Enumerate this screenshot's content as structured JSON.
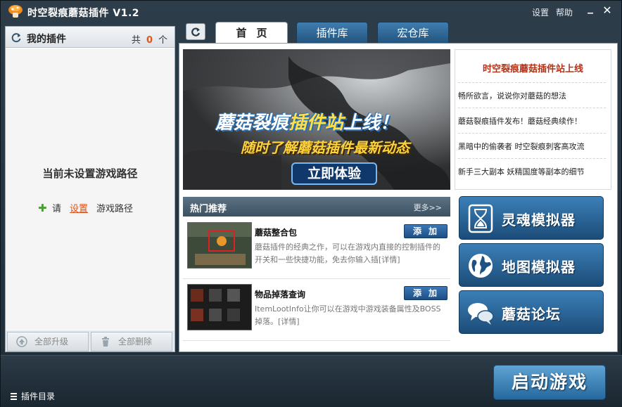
{
  "titlebar": {
    "title": "时空裂痕蘑菇插件 V1.2",
    "settings": "设置",
    "help": "帮助",
    "minimize": "▁",
    "close": "✕"
  },
  "left_panel": {
    "title": "我的插件",
    "count_prefix": "共",
    "count": "0",
    "count_suffix": "个",
    "no_path_message": "当前未设置游戏路径",
    "prompt_please": "请",
    "prompt_set_link": "设置",
    "prompt_game_path": "游戏路径",
    "upgrade_all": "全部升级",
    "delete_all": "全部删除"
  },
  "tabs": [
    {
      "label": "首页",
      "active": true
    },
    {
      "label": "插件库",
      "active": false
    },
    {
      "label": "宏仓库",
      "active": false
    }
  ],
  "banner": {
    "line1a": "蘑菇裂痕",
    "line1b": "插件站",
    "line1c": "上线！",
    "line2": "随时了解蘑菇插件最新动态",
    "button": "立即体验"
  },
  "news": {
    "title": "时空裂痕蘑菇插件站上线",
    "items": [
      "畅所欲言，说说你对蘑菇的想法",
      "蘑菇裂痕插件发布！蘑菇经典续作！",
      "黑暗中的偷袭者 时空裂痕刺客高攻流",
      "新手三大副本 妖精国度等副本的细节"
    ]
  },
  "hot": {
    "title": "热门推荐",
    "more": "更多>>",
    "plugins": [
      {
        "name": "蘑菇整合包",
        "add": "添加",
        "desc": "蘑菇插件的经典之作，可以在游戏内直接的控制插件的开关和一些快捷功能，免去你输入插",
        "detail": "[详情]"
      },
      {
        "name": "物品掉落查询",
        "add": "添加",
        "desc": "ItemLootInfo让你可以在游戏中游戏装备属性及BOSS掉落。",
        "detail": "[详情]"
      }
    ]
  },
  "tools": [
    {
      "label": "灵魂模拟器",
      "icon": "hourglass-icon"
    },
    {
      "label": "地图模拟器",
      "icon": "globe-icon"
    },
    {
      "label": "蘑菇论坛",
      "icon": "chat-bubbles-icon"
    }
  ],
  "bottom": {
    "plugin_dir": "插件目录",
    "launch": "启动游戏"
  }
}
